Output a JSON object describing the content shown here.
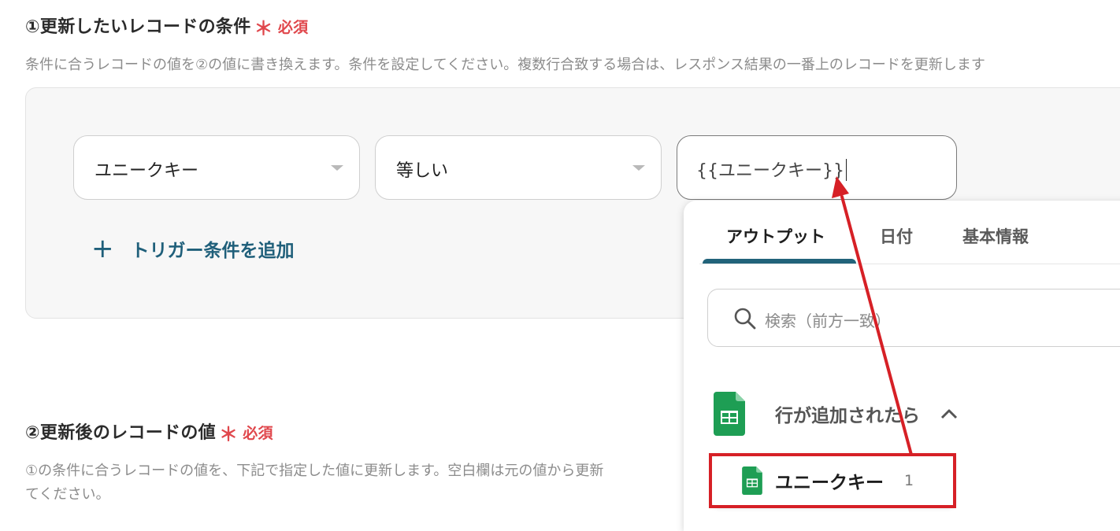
{
  "section1": {
    "title": "①更新したいレコードの条件",
    "required_star": "＊",
    "required_label": "必須",
    "description": "条件に合うレコードの値を②の値に書き換えます。条件を設定してください。複数行合致する場合は、レスポンス結果の一番上のレコードを更新します"
  },
  "condition": {
    "field_select": "ユニークキー",
    "operator_select": "等しい",
    "value_input": "{{ユニークキー}}",
    "add_trigger_label": "トリガー条件を追加"
  },
  "section2": {
    "title": "②更新後のレコードの値",
    "required_star": "＊",
    "required_label": "必須",
    "description_line1": "①の条件に合うレコードの値を、下記で指定した値に更新します。空白欄は元の値から更新",
    "description_line2": "てください。"
  },
  "dropdown": {
    "tabs": [
      "アウトプット",
      "日付",
      "基本情報"
    ],
    "active_tab": "アウトプット",
    "search_placeholder": "検索（前方一致）",
    "group_label": "行が追加されたら",
    "item_name": "ユニークキー",
    "item_count": "1"
  },
  "colors": {
    "accent": "#22637a",
    "required": "#e0474c",
    "annotation_red": "#d62026",
    "sheets_green": "#1e9e54"
  },
  "icons": {
    "add": "plus-icon",
    "search": "search-icon",
    "group": "google-sheets-icon",
    "collapse": "chevron-up-icon",
    "dropdown": "caret-down-icon"
  }
}
